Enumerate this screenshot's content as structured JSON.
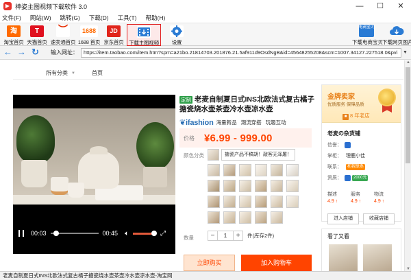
{
  "window": {
    "title": "神姿主图视频下载软件 3.0",
    "controls": {
      "minimize": "—",
      "maximize": "☐",
      "close": "✕"
    }
  },
  "menu": [
    "文件(F)",
    "网站(W)",
    "跳转(G)",
    "下载(D)",
    "工具(T)",
    "帮助(H)"
  ],
  "toolbar": {
    "taobao": {
      "icon_text": "淘",
      "label": "淘宝首页",
      "color": "#ff6a00"
    },
    "tmall": {
      "icon_text": "T",
      "label": "天猫首页",
      "color": "#e0101e"
    },
    "sumaitong": {
      "icon_text": "︶",
      "label": "速卖通首页",
      "color": "#e62e04"
    },
    "jd1688": {
      "icon_text": "1688",
      "label": "1688 首页",
      "color": "#ff6a00"
    },
    "jd": {
      "icon_text": "JD",
      "label": "京东首页",
      "color": "#e1251b"
    },
    "download_video": {
      "icon": "film-download-icon",
      "label": "下载主图视频"
    },
    "settings": {
      "icon": "gear-icon",
      "label": "设置"
    },
    "dl_dianshang": {
      "icon_text": "电商宝贝",
      "label": "下载电商宝贝"
    },
    "dl_webpage": {
      "icon": "cloud-download-icon",
      "label": "下载网页图片"
    }
  },
  "address": {
    "label": "输入网址：",
    "value": "https://item.taobao.com/item.htm?spm=a21bo.21814703.201876.21.5af911d9OsdNgB&id=45648255208&scm=1007.34127.227518.0&pvi"
  },
  "page": {
    "category_all": "所有分类",
    "category_home": "首页",
    "video": {
      "current_time": "00:03",
      "total_time": "00:45",
      "progress": 0.07,
      "volume": 1.0
    },
    "product": {
      "custom_tag": "定制",
      "title": "老麦自制夏日式INS北欧法式复古橘子搪瓷烧水壶茶壶冷水壶凉水壶",
      "brand": "ifashion",
      "brand_tags": [
        "海量新品",
        "潮流穿搭",
        "玩趣互动"
      ],
      "price_label": "价格",
      "price": "¥6.99 - 999.00",
      "sku_label": "颜色分类",
      "sku_selected_text": "搪瓷产品不稿胡！敲客无泽屠！",
      "qty_label": "数量",
      "qty_value": "1",
      "qty_minus": "−",
      "qty_plus": "+",
      "stock": "件(库存2件)",
      "buy_now": "立即购买",
      "add_cart": "加入购物车"
    },
    "seller": {
      "gold_title": "金牌卖家",
      "gold_sub": "优质服务 保障品质",
      "years": "8 年老店",
      "shop_name": "老麦の杂货铺",
      "credit_label": "信誉：",
      "keeper_label": "掌柜：",
      "keeper_value": "理鹿小佳",
      "contact_label": "联系：",
      "contact_badge": "和我联系",
      "qual_label": "资质：",
      "qual_badge": "2000元",
      "scores": [
        {
          "label": "描述",
          "value": "4.9 ↑"
        },
        {
          "label": "服务",
          "value": "4.9 ↑"
        },
        {
          "label": "物流",
          "value": "4.9 ↑"
        }
      ],
      "enter_shop": "进入店铺",
      "fav_shop": "收藏店铺",
      "seen_title": "看了又看"
    }
  },
  "statusbar": {
    "text": "老麦自制夏日式INS北欧法式复古橘子搪瓷烧水壶茶壶冷水壶凉水壶-淘宝网"
  },
  "colors": {
    "accent_orange": "#ff4400",
    "nav_blue": "#2a7bd4",
    "active_tool_border": "#e02020"
  }
}
